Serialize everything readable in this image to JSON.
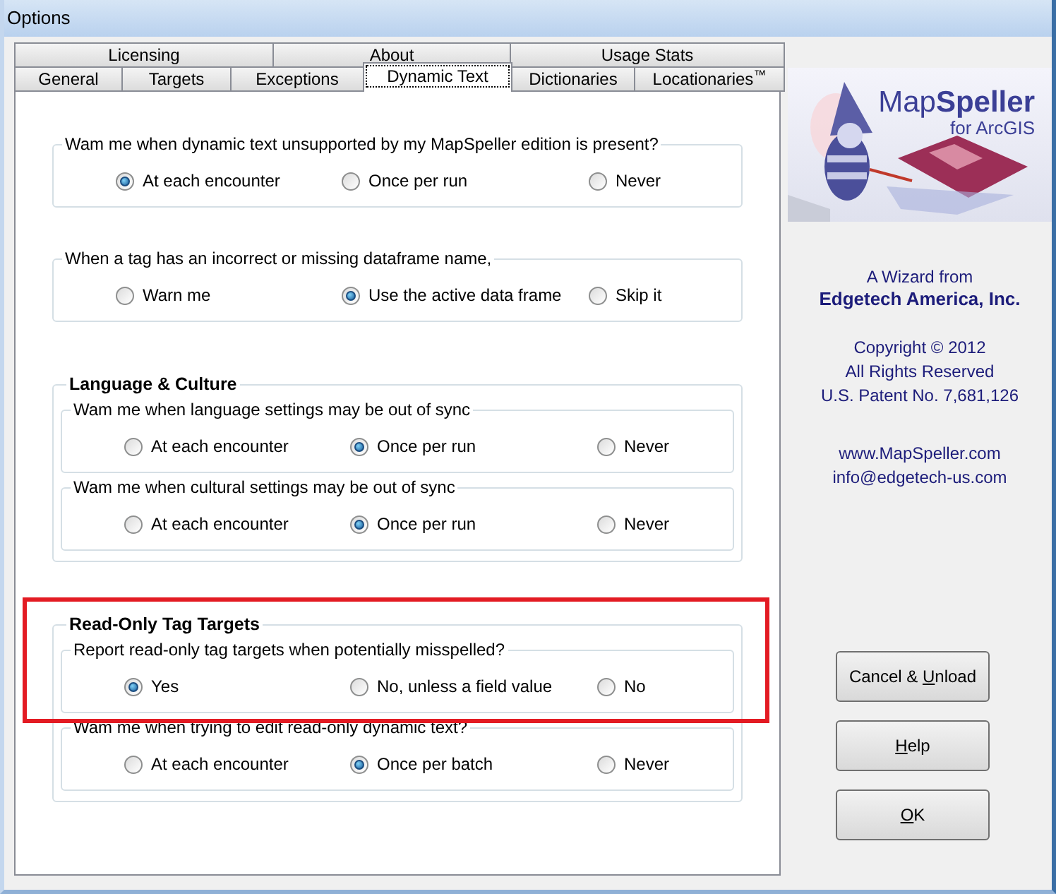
{
  "window": {
    "title": "Options"
  },
  "tabs": [
    [
      {
        "label": "Licensing",
        "selected": false
      },
      {
        "label": "About",
        "selected": false
      },
      {
        "label": "Usage Stats",
        "selected": false
      }
    ],
    [
      {
        "label": "General",
        "selected": false
      },
      {
        "label": "Targets",
        "selected": false
      },
      {
        "label": "Exceptions",
        "selected": false
      },
      {
        "label": "Dynamic Text",
        "selected": true
      },
      {
        "label": "Dictionaries",
        "selected": false
      },
      {
        "label": "Locationaries$^{™}$",
        "selected": false
      }
    ]
  ],
  "panel": [
    {
      "kind": "group",
      "question": "Wam me when dynamic text unsupported by my MapSpeller edition is present?",
      "options": [
        {
          "label": "At each encounter",
          "selected": true
        },
        {
          "label": "Once per run",
          "selected": false
        },
        {
          "label": "Never",
          "selected": false
        }
      ]
    },
    {
      "kind": "group",
      "question": "When a tag has an incorrect or missing dataframe name,",
      "options": [
        {
          "label": "Warn me",
          "selected": false
        },
        {
          "label": "Use the active data frame",
          "selected": true
        },
        {
          "label": "Skip it",
          "selected": false
        }
      ]
    },
    {
      "kind": "section",
      "heading": "Language & Culture",
      "highlighted": false,
      "groups": [
        {
          "question": "Wam me when language settings may be out of sync",
          "options": [
            {
              "label": "At each encounter",
              "selected": false
            },
            {
              "label": "Once per run",
              "selected": true
            },
            {
              "label": "Never",
              "selected": false
            }
          ]
        },
        {
          "question": "Wam me when cultural settings may be out of sync",
          "options": [
            {
              "label": "At each encounter",
              "selected": false
            },
            {
              "label": "Once per run",
              "selected": true
            },
            {
              "label": "Never",
              "selected": false
            }
          ]
        }
      ]
    },
    {
      "kind": "section",
      "heading": "Read-Only Tag Targets",
      "highlighted": true,
      "groups": [
        {
          "question": "Report read-only tag targets when potentially misspelled?",
          "options": [
            {
              "label": "Yes",
              "selected": true
            },
            {
              "label": "No, unless a field value",
              "selected": false
            },
            {
              "label": "No",
              "selected": false
            }
          ]
        },
        {
          "question": "Wam me when trying to edit read-only dynamic text?",
          "options": [
            {
              "label": "At each encounter",
              "selected": false
            },
            {
              "label": "Once per batch",
              "selected": true
            },
            {
              "label": "Never",
              "selected": false
            }
          ]
        }
      ]
    }
  ],
  "logo": {
    "title": "Map**Speller**",
    "subtitle": "for ArcGIS"
  },
  "about": {
    "tagline": "A Wizard from",
    "company": "Edgetech America, Inc.",
    "legal": [
      "Copyright © 2012",
      "All Rights Reserved",
      "U.S. Patent No. 7,681,126"
    ],
    "links": [
      "www.MapSpeller.com",
      "info@edgetech-us.com"
    ]
  },
  "buttons": [
    {
      "before": "Cancel & ",
      "accel": "U",
      "after": "nload"
    },
    {
      "accel": "H",
      "after": "elp"
    },
    {
      "accel": "O",
      "after": "K"
    }
  ]
}
